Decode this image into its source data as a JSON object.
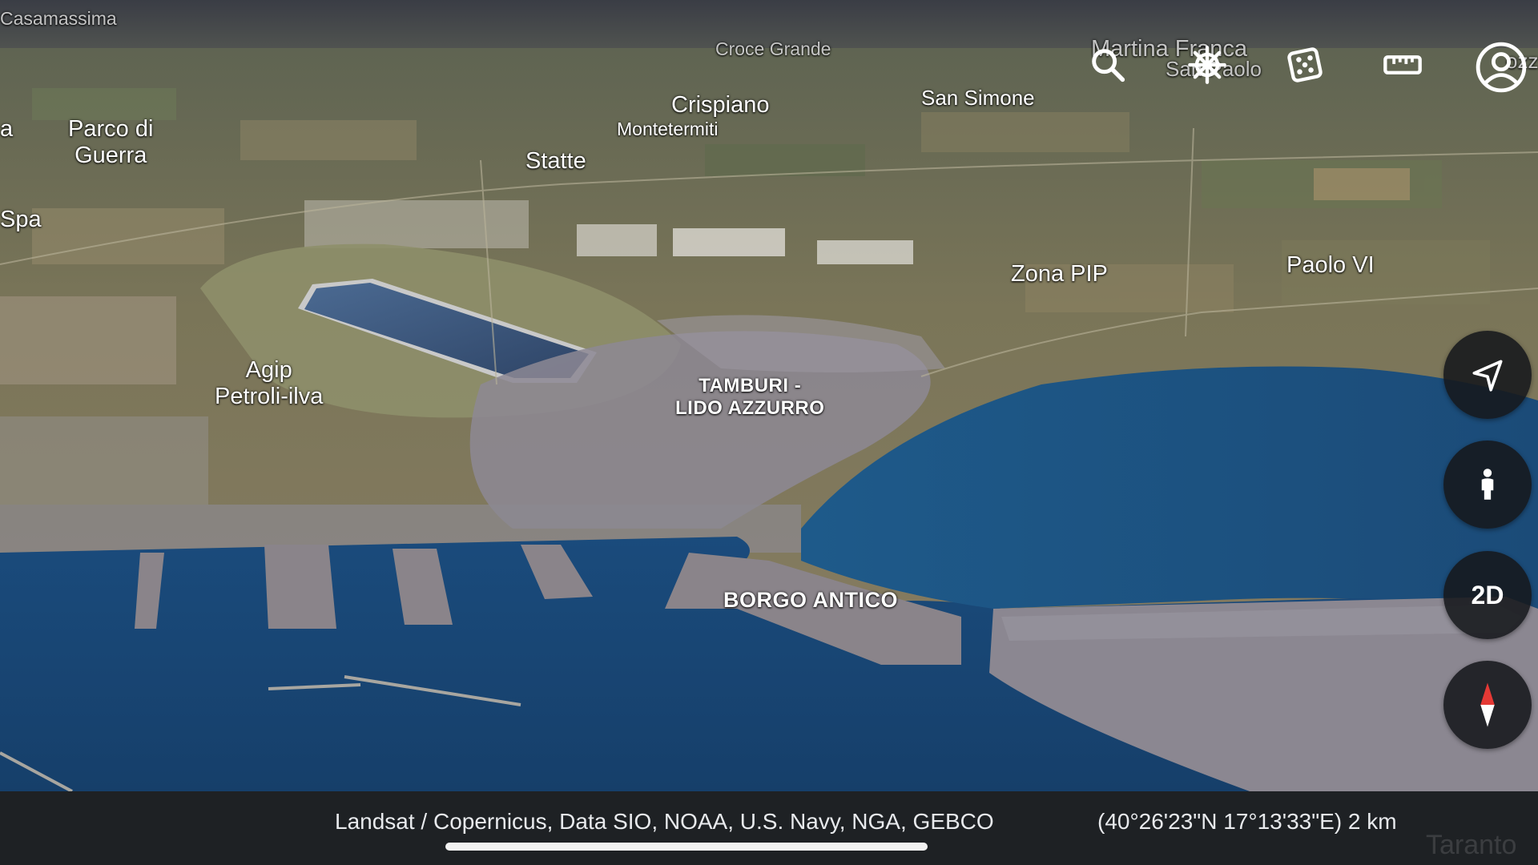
{
  "map": {
    "places": {
      "casamassima": "Casamassima",
      "croce_grande": "Croce Grande",
      "martina_franca": "Martina Franca",
      "san_paolo": "San Paolo",
      "crispiano": "Crispiano",
      "montetermiti": "Montetermiti",
      "san_simone": "San Simone",
      "parco_di_guerra": "Parco di\nGuerra",
      "statte": "Statte",
      "spa": "Spa",
      "a_edge": "a",
      "zona_pip": "Zona PIP",
      "paolo_vi": "Paolo VI",
      "agip": "Agip\nPetroli-ilva",
      "tamburi": "TAMBURI -\nLIDO AZZURRO",
      "borgo_antico": "BORGO ANTICO",
      "edge_right": "ozz"
    }
  },
  "toolbar": {
    "icons": [
      "search-icon",
      "voyager-wheel-icon",
      "feeling-lucky-dice-icon",
      "measure-ruler-icon",
      "account-icon"
    ]
  },
  "side_controls": {
    "icons": [
      "navigation-arrow-icon",
      "street-view-pegman-icon",
      "compass-icon"
    ],
    "toggle_2d_label": "2D"
  },
  "footer": {
    "attribution": "Landsat / Copernicus, Data SIO, NOAA, U.S. Navy, NGA, GEBCO",
    "coordinates": "(40°26'23\"N 17°13'33\"E) 2 km",
    "corner_label": "Taranto"
  },
  "colors": {
    "sea": "#1f4f7d",
    "land": "#7d7658",
    "city": "#8a8590",
    "bar": "#1e2124",
    "compass_red": "#e53935"
  }
}
